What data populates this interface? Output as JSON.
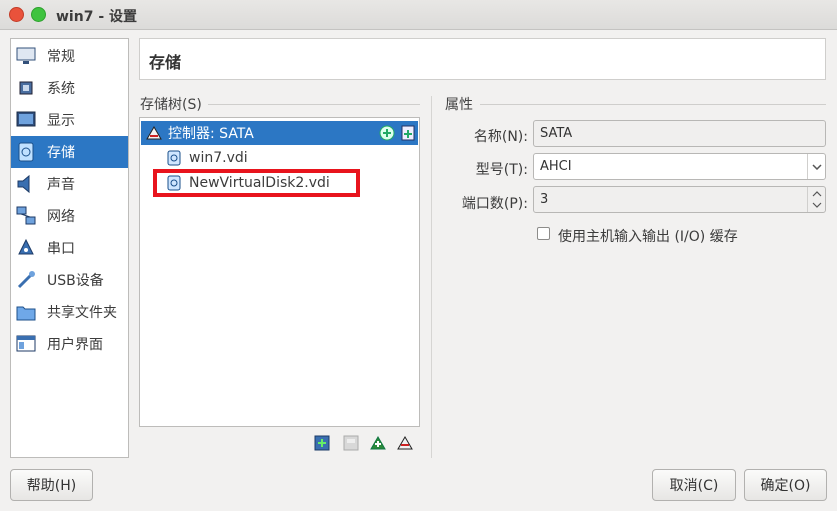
{
  "window": {
    "title": "win7 - 设置"
  },
  "sidebar": {
    "items": [
      {
        "label": "常规",
        "icon": "monitor-icon"
      },
      {
        "label": "系统",
        "icon": "chip-icon"
      },
      {
        "label": "显示",
        "icon": "display-icon"
      },
      {
        "label": "存储",
        "icon": "disk-icon",
        "active": true
      },
      {
        "label": "声音",
        "icon": "speaker-icon"
      },
      {
        "label": "网络",
        "icon": "network-icon"
      },
      {
        "label": "串口",
        "icon": "serial-port-icon"
      },
      {
        "label": "USB设备",
        "icon": "usb-icon"
      },
      {
        "label": "共享文件夹",
        "icon": "folder-icon"
      },
      {
        "label": "用户界面",
        "icon": "ui-icon"
      }
    ]
  },
  "header": {
    "title": "存储"
  },
  "storage_tree": {
    "label": "存储树(S)",
    "controller": "控制器: SATA",
    "disks": [
      "win7.vdi",
      "NewVirtualDisk2.vdi"
    ]
  },
  "attributes": {
    "label": "属性",
    "name_label": "名称(N):",
    "name_value": "SATA",
    "type_label": "型号(T):",
    "type_value": "AHCI",
    "port_label": "端口数(P):",
    "port_value": "3",
    "host_cache_label": "使用主机输入输出 (I/O) 缓存",
    "host_cache_checked": false
  },
  "buttons": {
    "help": "帮助(H)",
    "cancel": "取消(C)",
    "ok": "确定(O)"
  },
  "colors": {
    "selection": "#2c77c4",
    "highlight_box": "#e8141d"
  }
}
